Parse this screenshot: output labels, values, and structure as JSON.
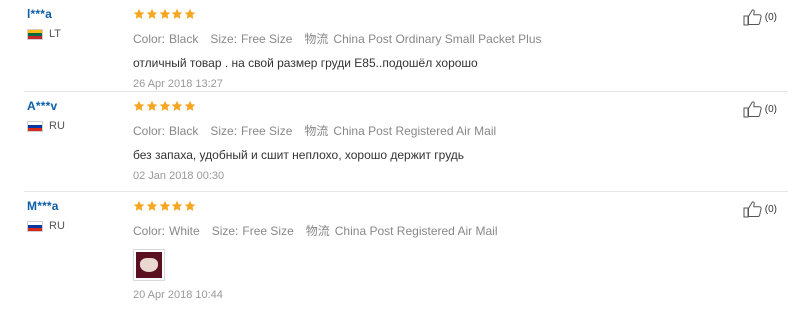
{
  "labels": {
    "color": "Color:",
    "size": "Size:",
    "shipping": "物流"
  },
  "colors": {
    "star": "#f5a623",
    "username": "#0b5ea8"
  },
  "reviews": [
    {
      "user": "l***a",
      "country": "LT",
      "flag": [
        "#fdb913",
        "#006a44",
        "#c1272d"
      ],
      "rating": 5,
      "color": "Black",
      "size": "Free Size",
      "shipping": "China Post Ordinary Small Packet Plus",
      "text": "отличный товар . на свой размер груди E85..подошёл хорошо",
      "date": "26 Apr 2018 13:27",
      "helpful": "(0)"
    },
    {
      "user": "A***v",
      "country": "RU",
      "flag": [
        "#ffffff",
        "#0039a6",
        "#d52b1e"
      ],
      "rating": 5,
      "color": "Black",
      "size": "Free Size",
      "shipping": "China Post Registered Air Mail",
      "text": "без запаха, удобный и сшит неплохо, хорошо держит грудь",
      "date": "02 Jan 2018 00:30",
      "helpful": "(0)"
    },
    {
      "user": "M***a",
      "country": "RU",
      "flag": [
        "#ffffff",
        "#0039a6",
        "#d52b1e"
      ],
      "rating": 5,
      "color": "White",
      "size": "Free Size",
      "shipping": "China Post Registered Air Mail",
      "text": "",
      "date": "20 Apr 2018 10:44",
      "helpful": "(0)",
      "has_photo": true
    }
  ]
}
